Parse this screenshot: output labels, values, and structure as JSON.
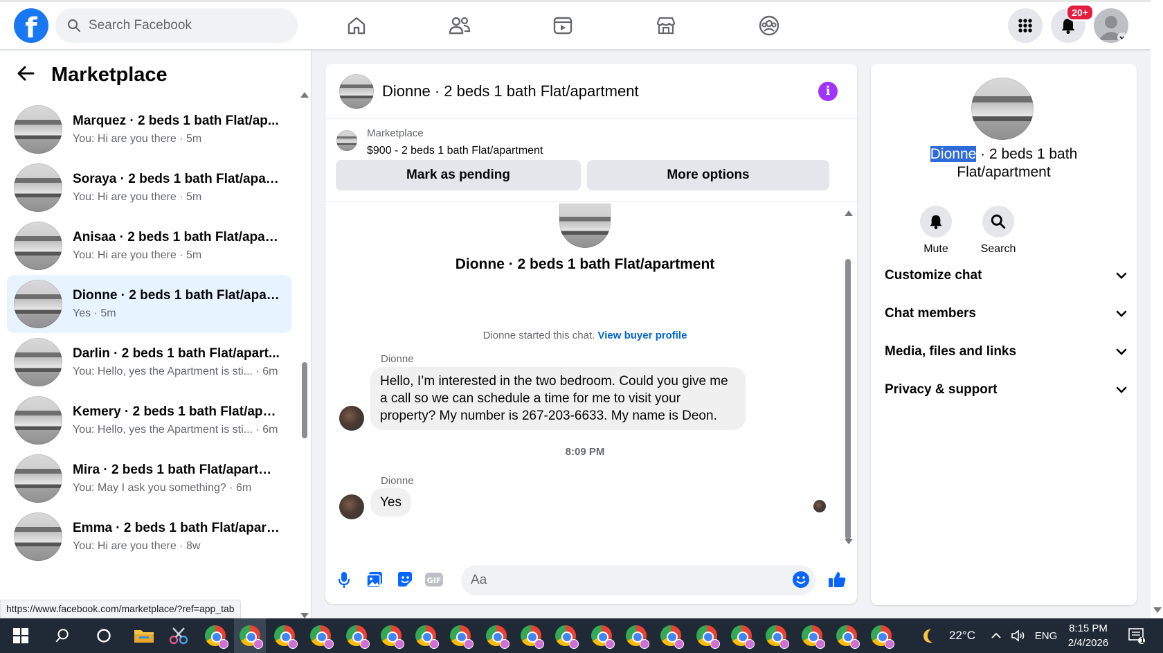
{
  "topbar": {
    "search_placeholder": "Search Facebook",
    "notification_count": "20+",
    "logo_icon": "facebook-logo",
    "nav_icons": [
      "home-icon",
      "friends-icon",
      "watch-icon",
      "marketplace-icon",
      "groups-icon"
    ]
  },
  "sidebar": {
    "title": "Marketplace",
    "conversations": [
      {
        "name": "Marquez · 2 beds 1 bath Flat/ap...",
        "preview": "You: Hi are you there · 5m"
      },
      {
        "name": "Soraya · 2 beds 1 bath Flat/apart...",
        "preview": "You: Hi are you there · 5m"
      },
      {
        "name": "Anisaa · 2 beds 1 bath Flat/apart...",
        "preview": "You: Hi are you there · 5m"
      },
      {
        "name": "Dionne · 2 beds 1 bath Flat/apar...",
        "preview": "Yes · 5m"
      },
      {
        "name": "Darlin · 2 beds 1 bath Flat/apart...",
        "preview": "You: Hello, yes the Apartment is sti... · 6m"
      },
      {
        "name": "Kemery · 2 beds 1 bath Flat/apar...",
        "preview": "You: Hello, yes the Apartment is sti... · 6m"
      },
      {
        "name": "Mira · 2 beds 1 bath Flat/apartm...",
        "preview": "You: May I ask you something? · 6m"
      },
      {
        "name": "Emma · 2 beds 1 bath Flat/apart...",
        "preview": "You: Hi are you there · 8w"
      }
    ],
    "status_url": "https://www.facebook.com/marketplace/?ref=app_tab"
  },
  "chat": {
    "title": "Dionne · 2 beds 1 bath Flat/apartment",
    "marketplace_label": "Marketplace",
    "listing": "$900 - 2 beds 1 bath Flat/apartment",
    "mark_pending": "Mark as pending",
    "more_options": "More options",
    "center_name": "Dionne · 2 beds 1 bath Flat/apartment",
    "started_text": "Dionne started this chat. ",
    "view_buyer_profile": "View buyer profile",
    "messages": [
      {
        "sender": "Dionne",
        "text": "Hello, I’m interested in the two bedroom. Could you give me a call so we can schedule a time for me to visit your property? My number is 267-203-6633. My name is Deon."
      },
      {
        "sender": "Dionne",
        "text": "Yes"
      }
    ],
    "timestamp": "8:09 PM",
    "composer_placeholder": "Aa"
  },
  "info_panel": {
    "name_highlight": "Dionne",
    "name_rest": " · 2 beds 1 bath Flat/apartment",
    "mute": "Mute",
    "search": "Search",
    "menu": [
      "Customize chat",
      "Chat members",
      "Media, files and links",
      "Privacy & support"
    ]
  },
  "taskbar": {
    "weather": "22°C",
    "lang": "ENG",
    "time": "8:15 PM",
    "date": "2/4/2026",
    "notification_badge": "1"
  },
  "colors": {
    "brand": "#1877f2",
    "active_row": "#e7f3ff",
    "link": "#0064d1",
    "info_purple": "#a033ff"
  }
}
